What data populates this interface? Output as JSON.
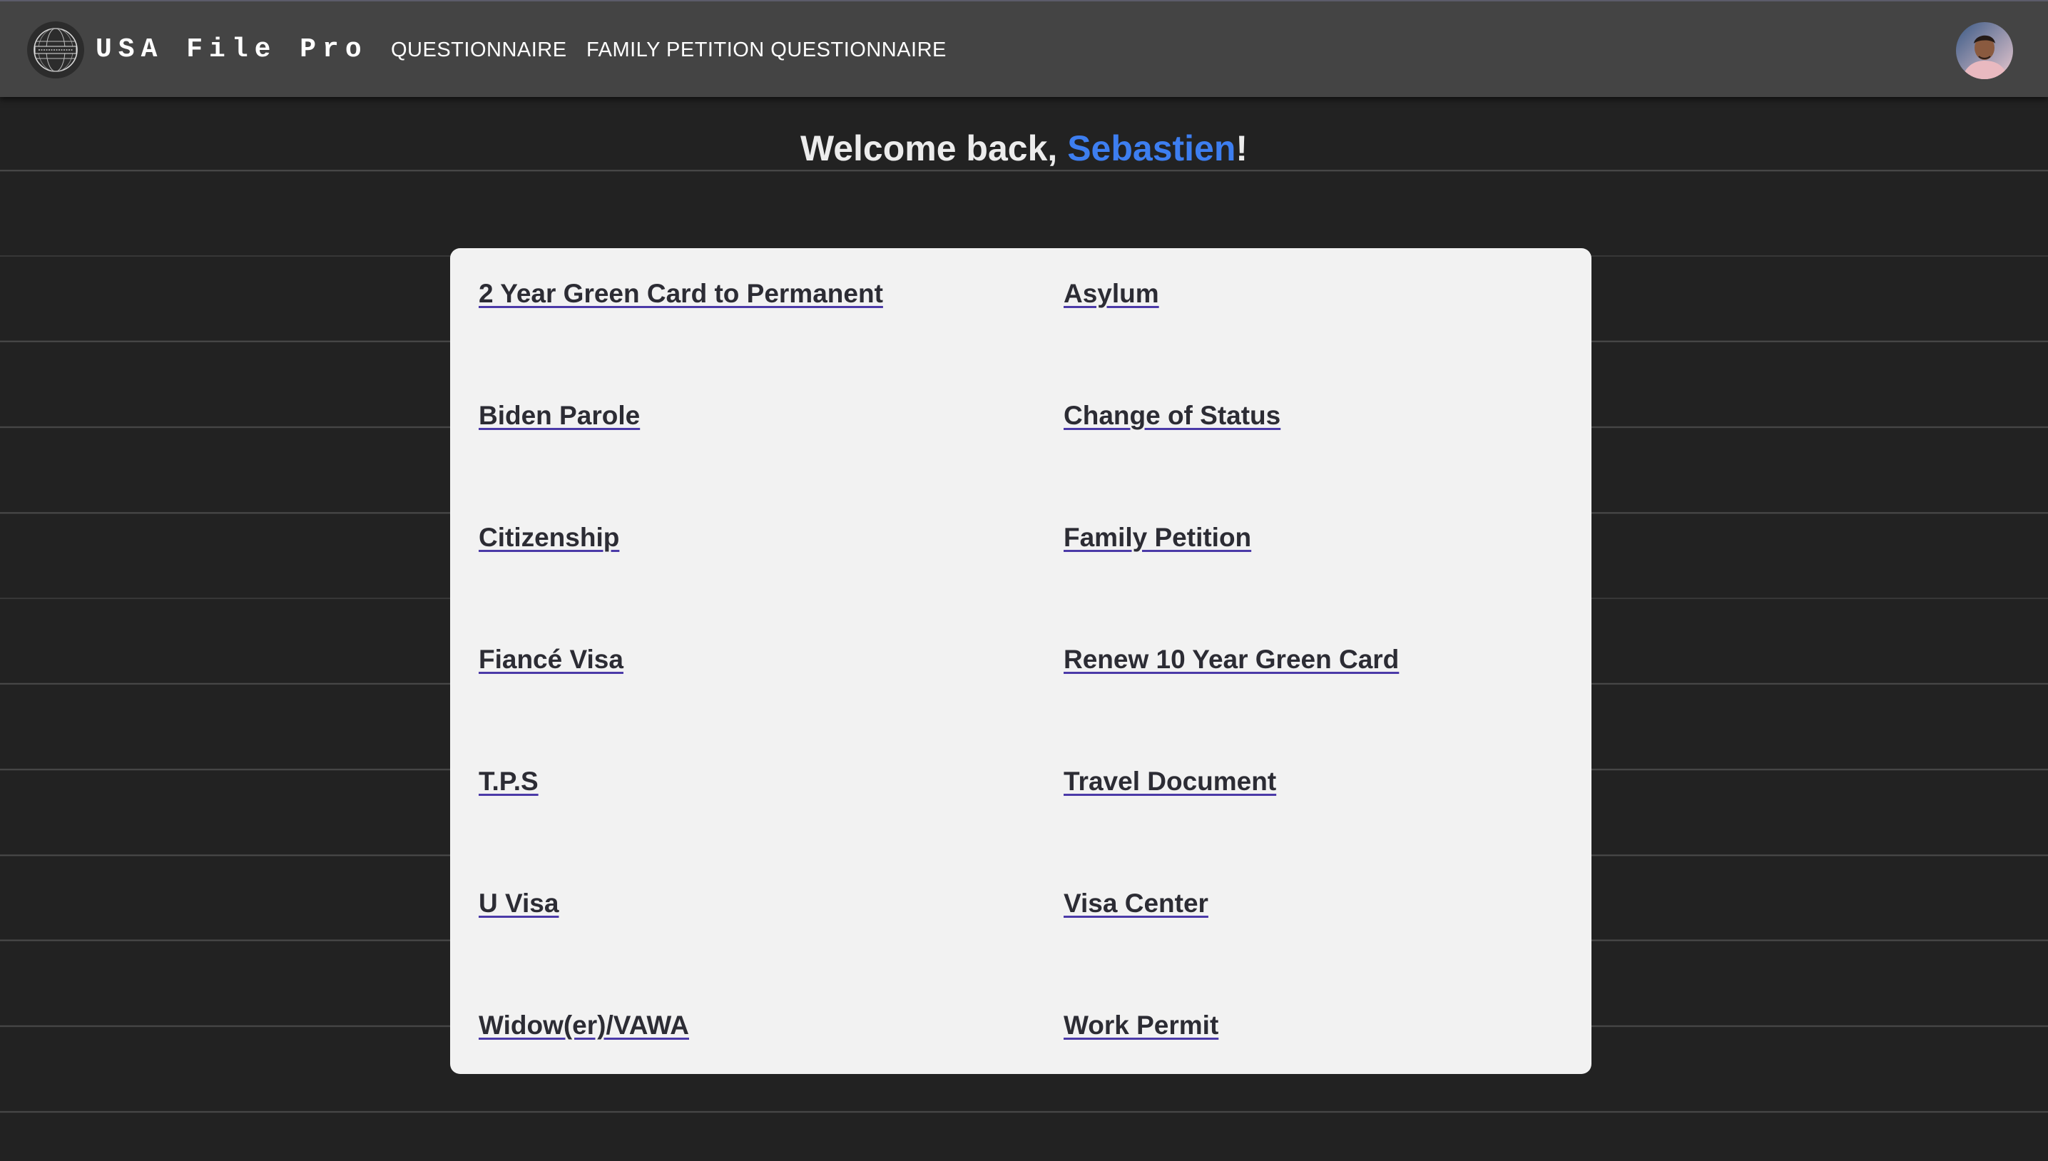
{
  "header": {
    "brand": "USA File Pro",
    "nav": [
      {
        "label": "QUESTIONNAIRE"
      },
      {
        "label": "FAMILY PETITION QUESTIONNAIRE"
      }
    ],
    "logo_icon": "globe-seal-icon",
    "avatar_icon": "user-avatar-icon"
  },
  "welcome": {
    "prefix": "Welcome back, ",
    "username": "Sebastien",
    "suffix": "!"
  },
  "services": [
    {
      "label": "2 Year Green Card to Permanent"
    },
    {
      "label": "Asylum"
    },
    {
      "label": "Biden Parole"
    },
    {
      "label": "Change of Status"
    },
    {
      "label": "Citizenship"
    },
    {
      "label": "Family Petition"
    },
    {
      "label": "Fiancé Visa"
    },
    {
      "label": "Renew 10 Year Green Card"
    },
    {
      "label": "T.P.S"
    },
    {
      "label": "Travel Document"
    },
    {
      "label": "U Visa"
    },
    {
      "label": "Visa Center"
    },
    {
      "label": "Widow(er)/VAWA"
    },
    {
      "label": "Work Permit"
    }
  ],
  "colors": {
    "background": "#222222",
    "navbar": "#444444",
    "card": "#f2f2f2",
    "username_accent": "#3d7ef0",
    "link_text": "#2c2c34",
    "link_underline": "#4b3aa8"
  }
}
